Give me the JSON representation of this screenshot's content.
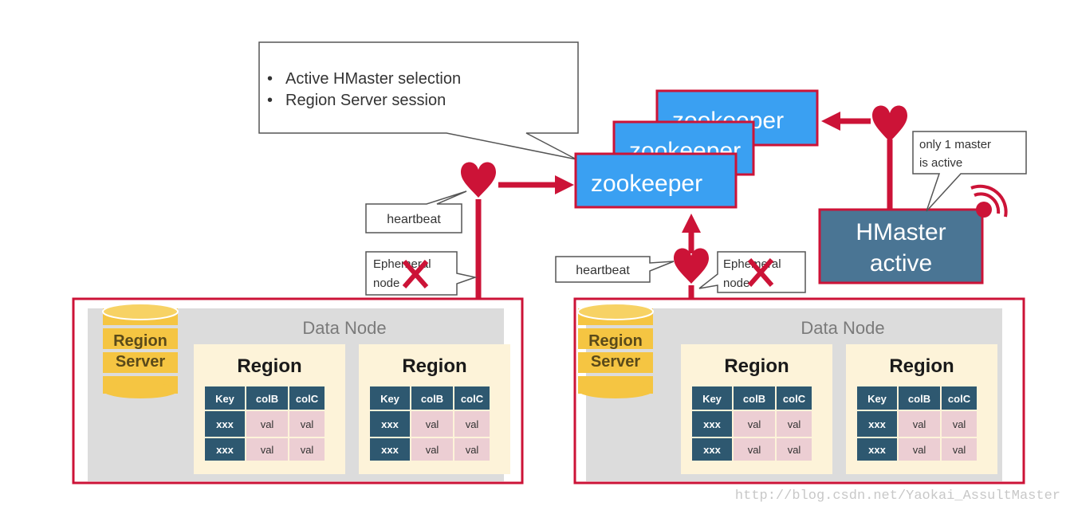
{
  "colors": {
    "accent_red": "#cc1337",
    "zookeeper_blue": "#3aa0f2",
    "hmaster_teal": "#4a7594",
    "datanode_gray": "#dcdcdc",
    "region_cream": "#fdf3d9",
    "table_header": "#2e5870",
    "table_cell": "#ecced3",
    "regionserver_gold": "#f5c542"
  },
  "callouts": {
    "zookeeper_roles": {
      "items": [
        "Active HMaster selection",
        "Region Server session"
      ]
    },
    "only_one_master": {
      "line1": "only 1 master",
      "line2": "is active"
    },
    "heartbeat_left": "heartbeat",
    "heartbeat_right": "heartbeat",
    "ephemeral_left": {
      "line1": "Ephemeral",
      "line2": "node"
    },
    "ephemeral_right": {
      "line1": "Ephemeral",
      "line2": "node"
    }
  },
  "zookeeper": {
    "label": "zookeeper",
    "count": 3
  },
  "hmaster": {
    "line1": "HMaster",
    "line2": "active"
  },
  "data_nodes": [
    {
      "title": "Data Node",
      "region_server": {
        "line1": "Region",
        "line2": "Server"
      },
      "regions": [
        {
          "title": "Region",
          "columns": [
            "Key",
            "colB",
            "colC"
          ],
          "rows": [
            [
              "xxx",
              "val",
              "val"
            ],
            [
              "xxx",
              "val",
              "val"
            ]
          ]
        },
        {
          "title": "Region",
          "columns": [
            "Key",
            "colB",
            "colC"
          ],
          "rows": [
            [
              "xxx",
              "val",
              "val"
            ],
            [
              "xxx",
              "val",
              "val"
            ]
          ]
        }
      ]
    },
    {
      "title": "Data Node",
      "region_server": {
        "line1": "Region",
        "line2": "Server"
      },
      "regions": [
        {
          "title": "Region",
          "columns": [
            "Key",
            "colB",
            "colC"
          ],
          "rows": [
            [
              "xxx",
              "val",
              "val"
            ],
            [
              "xxx",
              "val",
              "val"
            ]
          ]
        },
        {
          "title": "Region",
          "columns": [
            "Key",
            "colB",
            "colC"
          ],
          "rows": [
            [
              "xxx",
              "val",
              "val"
            ],
            [
              "xxx",
              "val",
              "val"
            ]
          ]
        }
      ]
    }
  ],
  "watermark": "http://blog.csdn.net/Yaokai_AssultMaster"
}
